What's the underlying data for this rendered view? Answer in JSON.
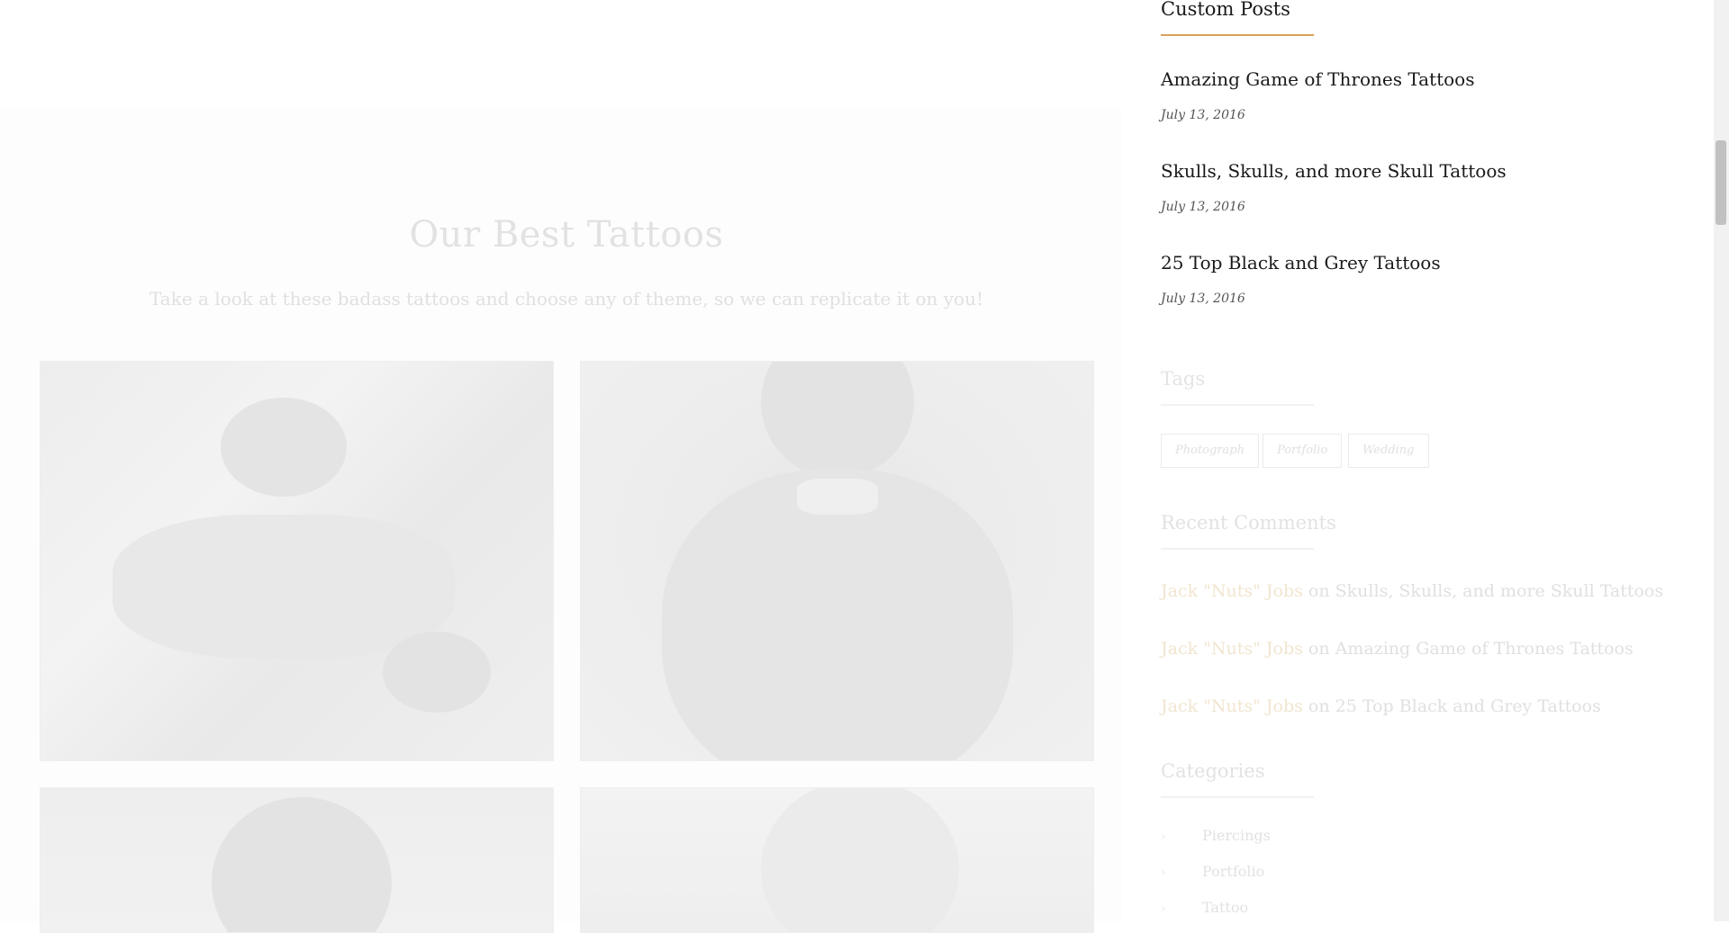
{
  "section": {
    "title": "Our Best Tattoos",
    "subtitle": "Take a look at these badass tattoos and choose any of theme, so we can replicate it on you!"
  },
  "sidebar": {
    "custom_posts": {
      "title": "Custom Posts",
      "posts": [
        {
          "title": "Amazing Game of Thrones Tattoos",
          "date": "July 13, 2016"
        },
        {
          "title": "Skulls, Skulls, and more Skull Tattoos",
          "date": "July 13, 2016"
        },
        {
          "title": "25 Top Black and Grey Tattoos",
          "date": "July 13, 2016"
        }
      ]
    },
    "tags": {
      "title": "Tags",
      "items": [
        "Photograph",
        "Portfolio",
        "Wedding"
      ]
    },
    "recent_comments": {
      "title": "Recent Comments",
      "items": [
        {
          "author": "Jack \"Nuts\" Jobs",
          "on": "on",
          "post": "Skulls, Skulls, and more Skull Tattoos"
        },
        {
          "author": "Jack \"Nuts\" Jobs",
          "on": "on",
          "post": "Amazing Game of Thrones Tattoos"
        },
        {
          "author": "Jack \"Nuts\" Jobs",
          "on": "on",
          "post": "25 Top Black and Grey Tattoos"
        }
      ]
    },
    "categories": {
      "title": "Categories",
      "items": [
        "Piercings",
        "Portfolio",
        "Tattoo"
      ]
    }
  },
  "colors": {
    "accent": "#d9a25a",
    "faded_text": "#e0e0e0",
    "author_link": "#f1e5cf"
  },
  "icons": {
    "category_bullet": "chevron-right-icon"
  }
}
